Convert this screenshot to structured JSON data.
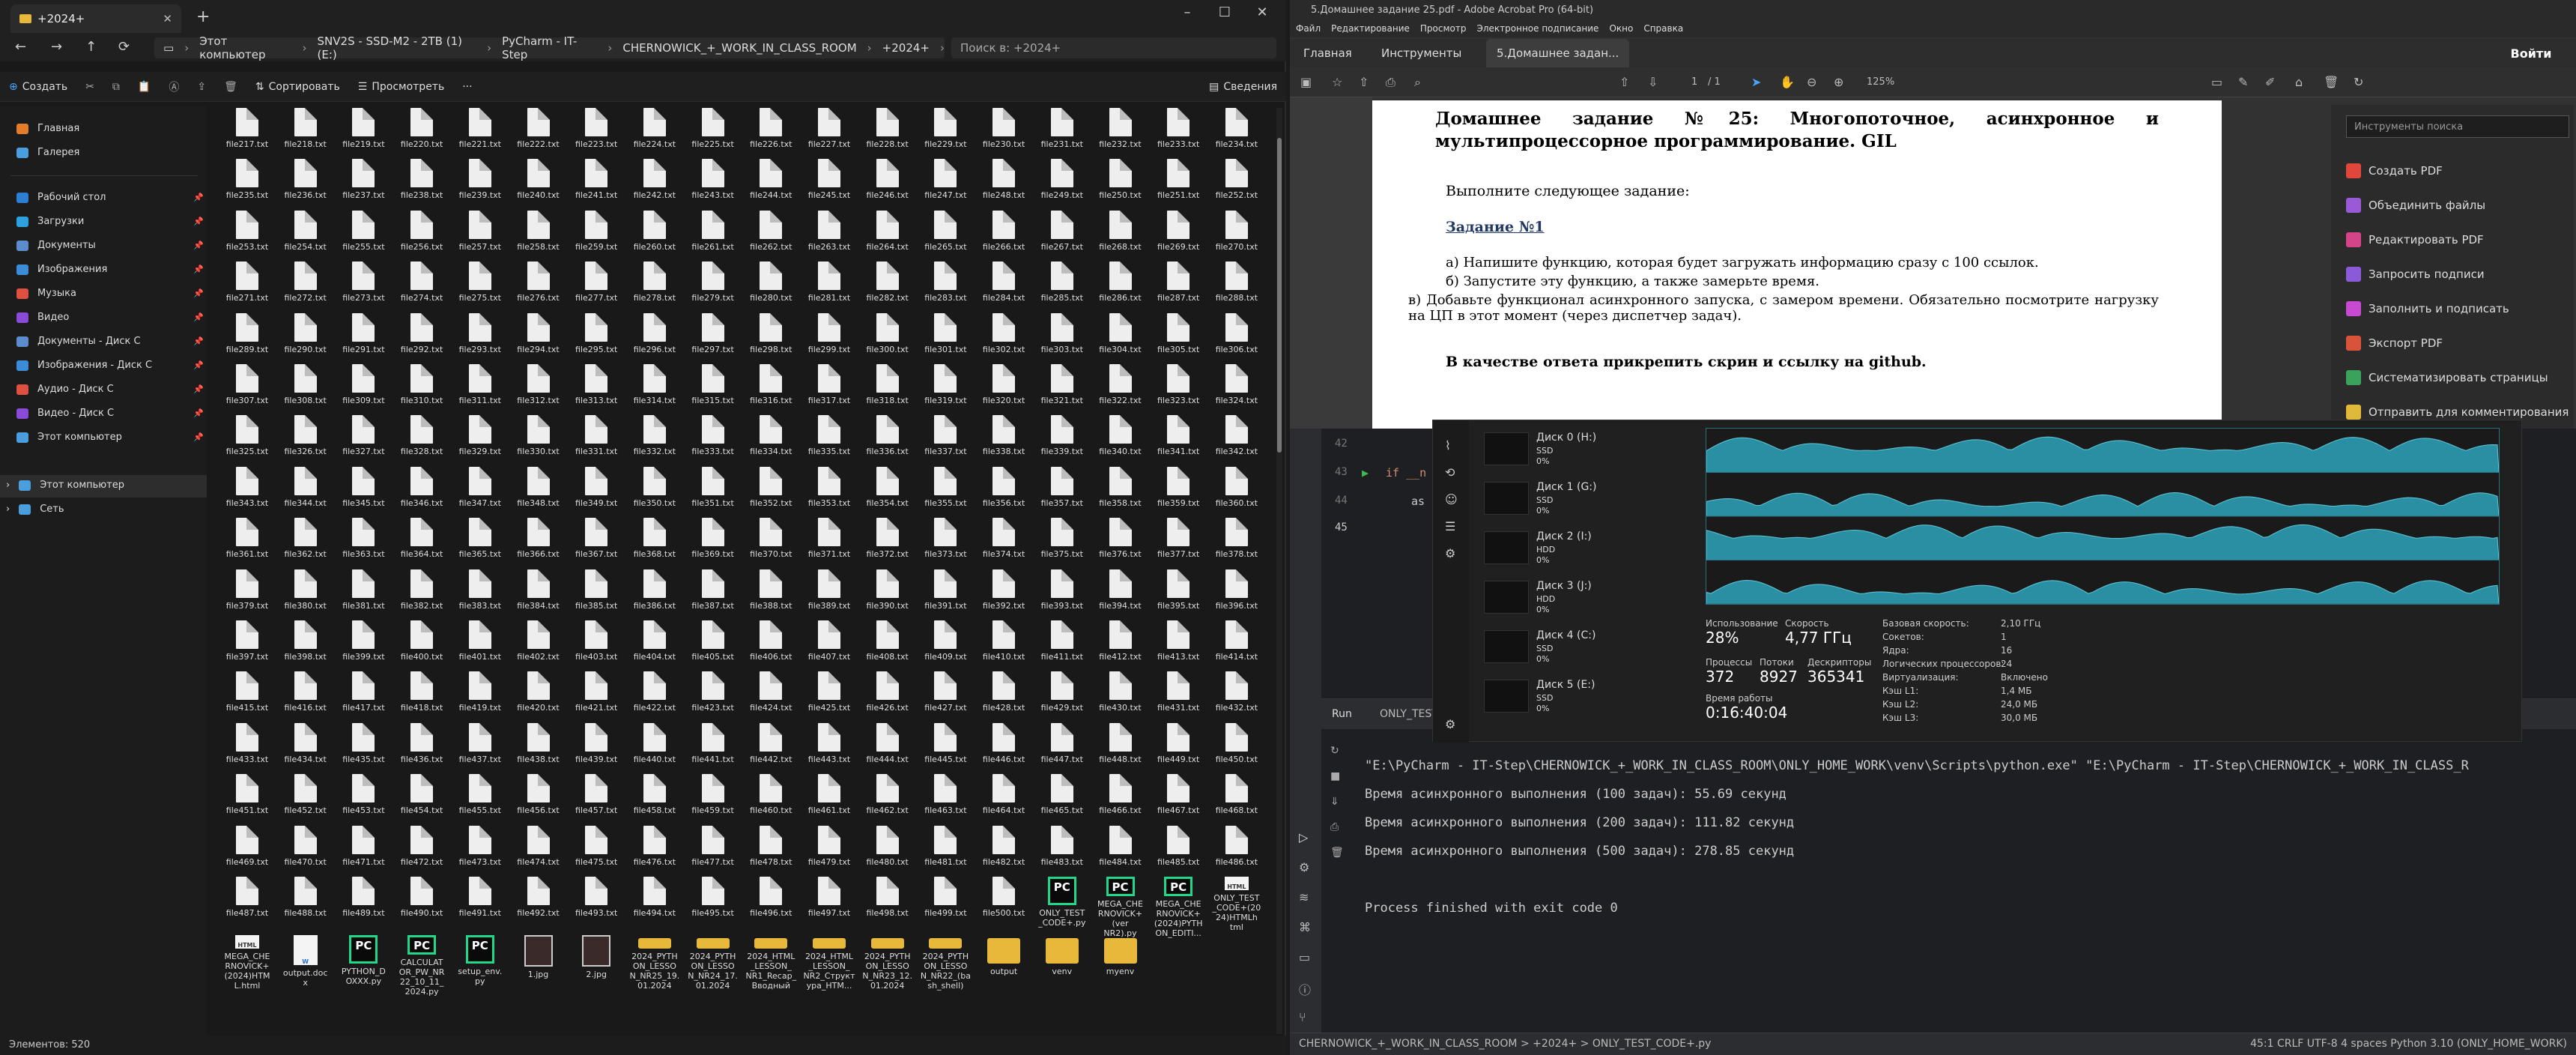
{
  "explorer": {
    "tab_title": "+2024+",
    "breadcrumbs": [
      "Этот компьютер",
      "SNV2S - SSD-M2 - 2TB (1) (E:)",
      "PyCharm - IT-Step",
      "CHERNOWICK_+_WORK_IN_CLASS_ROOM",
      "+2024+"
    ],
    "search_placeholder": "Поиск в: +2024+",
    "cmd": {
      "create": "Создать",
      "sort": "Сортировать",
      "view": "Просмотреть",
      "more": "···",
      "details": "Сведения"
    },
    "nav": [
      {
        "label": "Главная",
        "color": "#e37d2c",
        "pin": false
      },
      {
        "label": "Галерея",
        "color": "#4a9ede",
        "pin": false
      },
      {
        "label": "Рабочий стол",
        "color": "#2d7fd4",
        "pin": true
      },
      {
        "label": "Загрузки",
        "color": "#2da0e0",
        "pin": true
      },
      {
        "label": "Документы",
        "color": "#5c8ccc",
        "pin": true
      },
      {
        "label": "Изображения",
        "color": "#3b8bd9",
        "pin": true
      },
      {
        "label": "Музыка",
        "color": "#e05040",
        "pin": true
      },
      {
        "label": "Видео",
        "color": "#8a4ad8",
        "pin": true
      },
      {
        "label": "Документы - Диск С",
        "color": "#5c8ccc",
        "pin": true
      },
      {
        "label": "Изображения - Диск С",
        "color": "#3b8bd9",
        "pin": true
      },
      {
        "label": "Аудио - Диск С",
        "color": "#e05040",
        "pin": true
      },
      {
        "label": "Видео - Диск С",
        "color": "#8a4ad8",
        "pin": true
      },
      {
        "label": "Этот компьютер",
        "color": "#4a9ede",
        "pin": true
      },
      {
        "label": "Этот компьютер",
        "color": "#4a9ede",
        "pin": false
      },
      {
        "label": "Сеть",
        "color": "#4a9ede",
        "pin": false
      }
    ],
    "txt_first": 217,
    "txt_last": 500,
    "last_row_items": [
      {
        "label": "ONLY_TEST\n_CODE+.py",
        "kind": "pc"
      },
      {
        "label": "MEGA_CHE\nRNOVICK+\n(ver\nNR2).py",
        "kind": "pc"
      },
      {
        "label": "MEGA_CHE\nRNOVICK+\n(2024)PYTH\nON_EDITI...",
        "kind": "pc"
      },
      {
        "label": "ONLY_TEST\n_CODE+(20\n24)HTMLh\ntml",
        "kind": "html"
      }
    ],
    "bottom_row": [
      {
        "label": "MEGA_CHE\nRNOVICK+\n(2024)HTM\nL.html",
        "kind": "html"
      },
      {
        "label": "output.doc\nx",
        "kind": "doc"
      },
      {
        "label": "PYTHON_D\nOXXX.py",
        "kind": "pc"
      },
      {
        "label": "CALCULAT\nOR_PW_NR\n22_10_11_\n2024.py",
        "kind": "pc"
      },
      {
        "label": "setup_env.\npy",
        "kind": "pc"
      },
      {
        "label": "1.jpg",
        "kind": "img"
      },
      {
        "label": "2.jpg",
        "kind": "img"
      },
      {
        "label": "2024_PYTH\nON_LESSO\nN_NR25_19.\n01.2024",
        "kind": "folder"
      },
      {
        "label": "2024_PYTH\nON_LESSO\nN_NR24_17.\n01.2024",
        "kind": "folder"
      },
      {
        "label": "2024_HTML\n_LESSON_\nNR1_Recap_\nВводный",
        "kind": "folder"
      },
      {
        "label": "2024_HTML\n_LESSON_\nNR2_Структ\nура_HTM...",
        "kind": "folder"
      },
      {
        "label": "2024_PYTH\nON_LESSO\nN_NR23_12.\n01.2024",
        "kind": "folder"
      },
      {
        "label": "2024_PYTH\nON_LESSO\nN_NR22_(ba\nsh_shell)",
        "kind": "folder"
      },
      {
        "label": "output",
        "kind": "folder"
      },
      {
        "label": "venv",
        "kind": "folder"
      },
      {
        "label": "myenv",
        "kind": "folder"
      }
    ],
    "status": "Элементов: 520"
  },
  "acrobat": {
    "title": "5.Домашнее задание 25.pdf - Adobe Acrobat Pro (64-bit)",
    "menu": [
      "Файл",
      "Редактирование",
      "Просмотр",
      "Электронное подписание",
      "Окно",
      "Справка"
    ],
    "tabs": [
      "Главная",
      "Инструменты",
      "5.Домашнее задан..."
    ],
    "signin": "Войти",
    "page_num": "1",
    "page_total": "/ 1",
    "zoom": "125%",
    "doc": {
      "heading": "Домашнее задание №25: Многопоточное, асинхронное и мультипроцессорное программирование. GIL",
      "intro": "Выполните следующее задание:",
      "task_title": "Задание №1",
      "a": "а) Напишите функцию, которая будет загружать информацию сразу с 100 ссылок.",
      "b": "б) Запустите эту функцию, а также замерьте время.",
      "c": "в) Добавьте функционал асинхронного запуска, с замером времени. Обязательно посмотрите нагрузку на ЦП в этот момент (через диспетчер задач).",
      "answer": "В качестве ответа прикрепить скрин и ссылку на github."
    },
    "tools_search": "Инструменты поиска",
    "tools": [
      {
        "label": "Создать PDF",
        "color": "#e0463a"
      },
      {
        "label": "Объединить файлы",
        "color": "#9a5ad8"
      },
      {
        "label": "Редактировать PDF",
        "color": "#d4448a"
      },
      {
        "label": "Запросить подписи",
        "color": "#8a5ad8"
      },
      {
        "label": "Заполнить и подписать",
        "color": "#c84ad0"
      },
      {
        "label": "Экспорт PDF",
        "color": "#d9523a"
      },
      {
        "label": "Систематизировать страницы",
        "color": "#3aa25a"
      },
      {
        "label": "Отправить для комментирования",
        "color": "#e0b83a"
      }
    ]
  },
  "pycharm": {
    "lines": [
      "42",
      "43",
      "44",
      "45"
    ],
    "code": "if __n",
    "code2": "as",
    "run_tab": "Run",
    "run_config": "ONLY_TEST...",
    "output": [
      "\"E:\\PyCharm - IT-Step\\CHERNOWICK_+_WORK_IN_CLASS_ROOM\\ONLY_HOME_WORK\\venv\\Scripts\\python.exe\" \"E:\\PyCharm - IT-Step\\CHERNOWICK_+_WORK_IN_CLASS_R",
      "Время асинхронного выполнения (100 задач): 55.69 секунд",
      "Время асинхронного выполнения (200 задач): 111.82 секунд",
      "Время асинхронного выполнения (500 задач): 278.85 секунд",
      "",
      "Process finished with exit code 0"
    ],
    "status_left": "CHERNOWICK_+_WORK_IN_CLASS_ROOM  >  +2024+  >  ONLY_TEST_CODE+.py",
    "status_right": "45:1   CRLF   UTF-8   4 spaces   Python 3.10 (ONLY_HOME_WORK)"
  },
  "taskmgr": {
    "disks": [
      {
        "name": "Диск 0 (H:)",
        "type": "SSD",
        "pct": "0%"
      },
      {
        "name": "Диск 1 (G:)",
        "type": "SSD",
        "pct": "0%"
      },
      {
        "name": "Диск 2 (I:)",
        "type": "HDD",
        "pct": "0%"
      },
      {
        "name": "Диск 3 (J:)",
        "type": "HDD",
        "pct": "0%"
      },
      {
        "name": "Диск 4 (C:)",
        "type": "SSD",
        "pct": "0%"
      },
      {
        "name": "Диск 5 (E:)",
        "type": "SSD",
        "pct": "0%"
      }
    ],
    "stats": {
      "usage_label": "Использование",
      "usage": "28%",
      "speed_label": "Скорость",
      "speed": "4,77 ГГц",
      "proc_label": "Процессы",
      "proc": "372",
      "threads_label": "Потоки",
      "threads": "8927",
      "handles_label": "Дескрипторы",
      "handles": "365341",
      "uptime_label": "Время работы",
      "uptime": "0:16:40:04"
    },
    "details": [
      [
        "Базовая скорость:",
        "2,10 ГГц"
      ],
      [
        "Сокетов:",
        "1"
      ],
      [
        "Ядра:",
        "16"
      ],
      [
        "Логических процессоров:",
        "24"
      ],
      [
        "Виртуализация:",
        "Включено"
      ],
      [
        "Кэш L1:",
        "1,4 МБ"
      ],
      [
        "Кэш L2:",
        "24,0 МБ"
      ],
      [
        "Кэш L3:",
        "30,0 МБ"
      ]
    ]
  }
}
